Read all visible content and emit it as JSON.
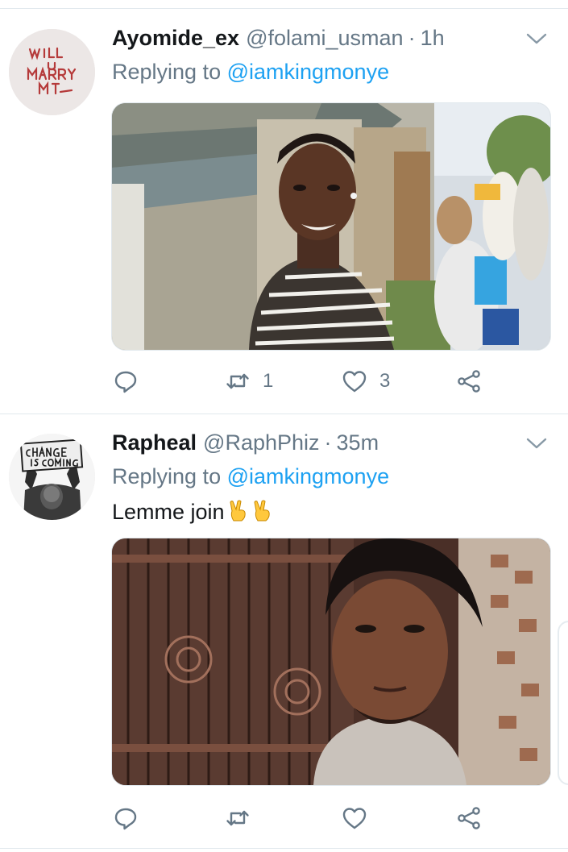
{
  "tweets": [
    {
      "display_name": "Ayomide_ex",
      "handle": "@folami_usman",
      "separator": "·",
      "time": "1h",
      "replying_prefix": "Replying to",
      "replying_to": "@iamkingmonye",
      "avatar_text": "WILL U MARRY ME",
      "actions": {
        "reply_count": "",
        "retweet_count": "1",
        "like_count": "3"
      }
    },
    {
      "display_name": "Rapheal",
      "handle": "@RaphPhiz",
      "separator": "·",
      "time": "35m",
      "replying_prefix": "Replying to",
      "replying_to": "@iamkingmonye",
      "text": "Lemme join",
      "avatar_text": "CHANGE IS COMING",
      "actions": {
        "reply_count": "",
        "retweet_count": "",
        "like_count": ""
      }
    }
  ],
  "icons": {
    "reply": "reply-icon",
    "retweet": "retweet-icon",
    "like": "like-icon",
    "share": "share-icon",
    "menu": "chevron-down-icon",
    "emoji": "victory-hand-emoji"
  },
  "colors": {
    "link": "#1da1f2",
    "secondary_text": "#657786",
    "primary_text": "#14171a",
    "divider": "#e1e8ed"
  }
}
